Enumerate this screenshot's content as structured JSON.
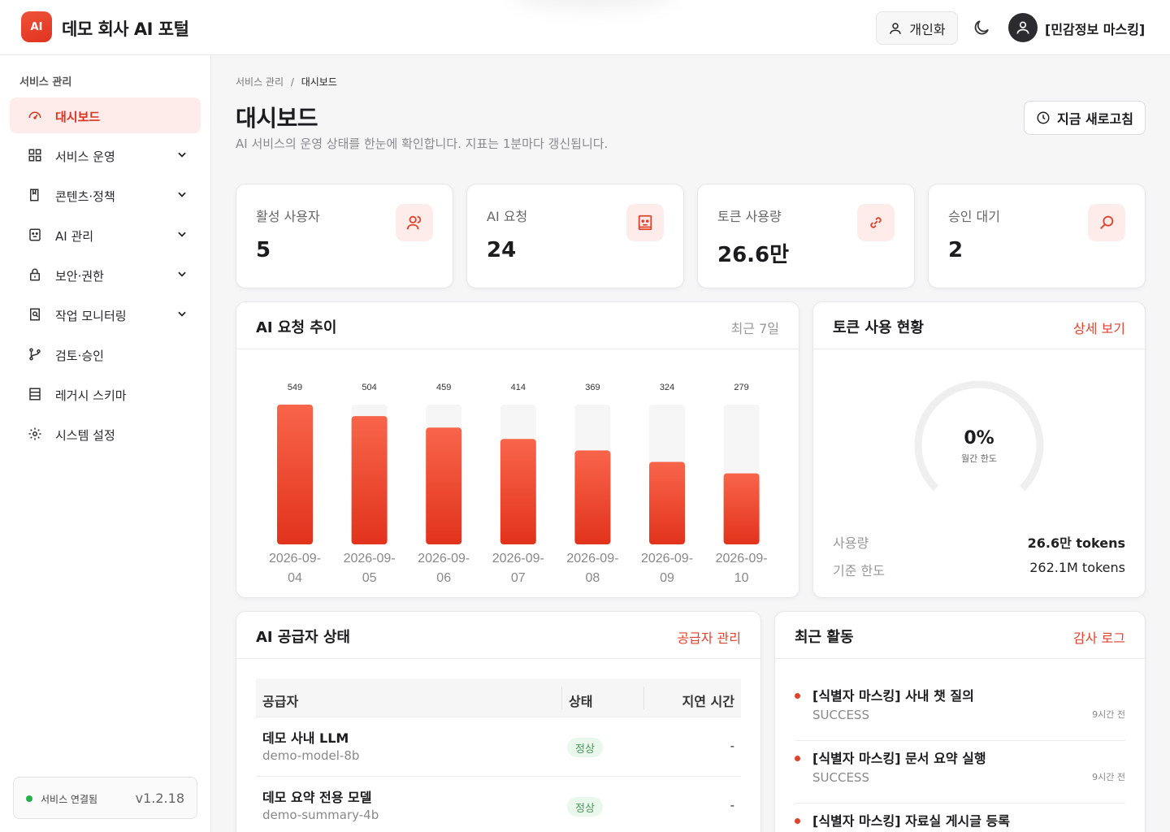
{
  "header": {
    "logo_text": "AI",
    "app_title": "데모 회사 AI 포털",
    "personal_btn": "개인화",
    "user_name": "[민감정보 마스킹]"
  },
  "sidebar": {
    "section": "서비스 관리",
    "items": [
      {
        "label": "대시보드",
        "icon": "dashboard-icon",
        "active": true
      },
      {
        "label": "서비스 운영",
        "icon": "grid-icon",
        "expandable": true
      },
      {
        "label": "콘텐츠·정책",
        "icon": "book-icon",
        "expandable": true
      },
      {
        "label": "AI 관리",
        "icon": "robot-icon",
        "expandable": true
      },
      {
        "label": "보안·권한",
        "icon": "lock-icon",
        "expandable": true
      },
      {
        "label": "작업 모니터링",
        "icon": "monitor-search-icon",
        "expandable": true
      },
      {
        "label": "검토·승인",
        "icon": "git-branch-icon"
      },
      {
        "label": "레거시 스키마",
        "icon": "table-icon"
      },
      {
        "label": "시스템 설정",
        "icon": "gear-icon"
      }
    ],
    "status": "서비스 연결됨",
    "version": "v1.2.18"
  },
  "page": {
    "breadcrumb_parent": "서비스 관리",
    "breadcrumb_sep": "/",
    "breadcrumb_current": "대시보드",
    "title": "대시보드",
    "description": "AI 서비스의 운영 상태를 한눈에 확인합니다. 지표는 1분마다 갱신됩니다.",
    "refresh_label": "지금 새로고침"
  },
  "kpis": [
    {
      "label": "활성 사용자",
      "value": "5",
      "icon": "users-icon"
    },
    {
      "label": "AI 요청",
      "value": "24",
      "icon": "robot-icon"
    },
    {
      "label": "토큰 사용량",
      "value": "26.6만",
      "icon": "link-icon"
    },
    {
      "label": "승인 대기",
      "value": "2",
      "icon": "search-icon"
    }
  ],
  "requests_card": {
    "title": "AI 요청 추이",
    "meta": "최근 7일"
  },
  "chart_data": {
    "type": "bar",
    "categories": [
      "2026-09-04",
      "2026-09-05",
      "2026-09-06",
      "2026-09-07",
      "2026-09-08",
      "2026-09-09",
      "2026-09-10"
    ],
    "values": [
      549,
      504,
      459,
      414,
      369,
      324,
      279
    ],
    "ylim": [
      0,
      549
    ],
    "grid": false,
    "bar_color": "#e8381f"
  },
  "token_card": {
    "title": "토큰 사용 현황",
    "link": "상세 보기",
    "gauge_value": "0%",
    "gauge_fraction": 0,
    "gauge_sub": "월간 한도",
    "usage_label": "사용량",
    "usage_value": "26.6만 tokens",
    "limit_label": "기준 한도",
    "limit_value": "262.1M tokens"
  },
  "providers_card": {
    "title": "AI 공급자 상태",
    "link": "공급자 관리",
    "columns": [
      "공급자",
      "상태",
      "지연 시간"
    ],
    "rows": [
      {
        "name": "데모 사내 LLM",
        "model": "demo-model-8b",
        "status": "정상",
        "latency": "-"
      },
      {
        "name": "데모 요약 전용 모델",
        "model": "demo-summary-4b",
        "status": "정상",
        "latency": "-"
      }
    ]
  },
  "activity_card": {
    "title": "최근 활동",
    "link": "감사 로그",
    "items": [
      {
        "title": "[식별자 마스킹] 사내 챗 질의",
        "status": "SUCCESS",
        "time": "9시간 전"
      },
      {
        "title": "[식별자 마스킹] 문서 요약 실행",
        "status": "SUCCESS",
        "time": "9시간 전"
      },
      {
        "title": "[식별자 마스킹] 자료실 게시글 등록",
        "status": "",
        "time": ""
      }
    ]
  },
  "colors": {
    "accent": "#e0432c",
    "accent_soft": "#fdecea",
    "success": "#22b14c"
  }
}
